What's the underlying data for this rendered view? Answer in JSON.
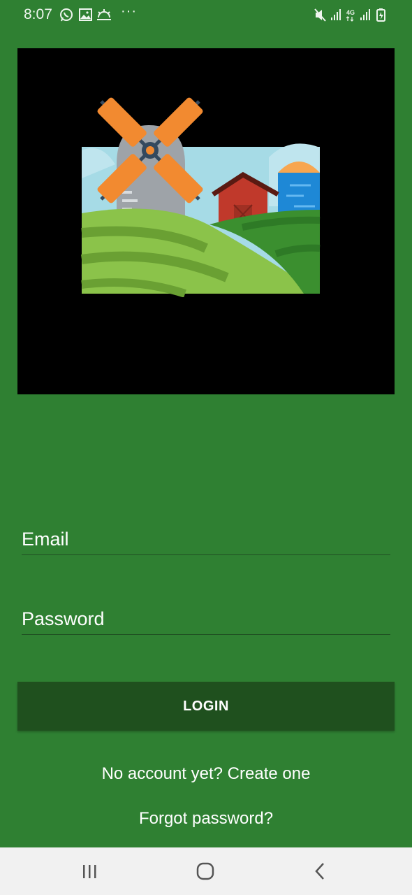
{
  "status_bar": {
    "time": "8:07",
    "left_icons": [
      "whatsapp-icon",
      "gallery-icon",
      "weather-icon"
    ],
    "more": "···",
    "right_icons": [
      "mute-icon",
      "signal-icon",
      "4g-icon",
      "signal-icon",
      "battery-charging-icon"
    ],
    "network": "4G"
  },
  "hero": {
    "image": "farm-illustration"
  },
  "form": {
    "email_placeholder": "Email",
    "password_placeholder": "Password",
    "login_label": "LOGIN"
  },
  "links": {
    "create_account": "No account yet? Create one",
    "forgot_password": "Forgot password?"
  },
  "nav": {
    "icons": [
      "recents-icon",
      "home-icon",
      "back-icon"
    ]
  },
  "colors": {
    "background": "#2f8032",
    "button": "#1f501e",
    "nav_bar": "#f1f1f1"
  }
}
